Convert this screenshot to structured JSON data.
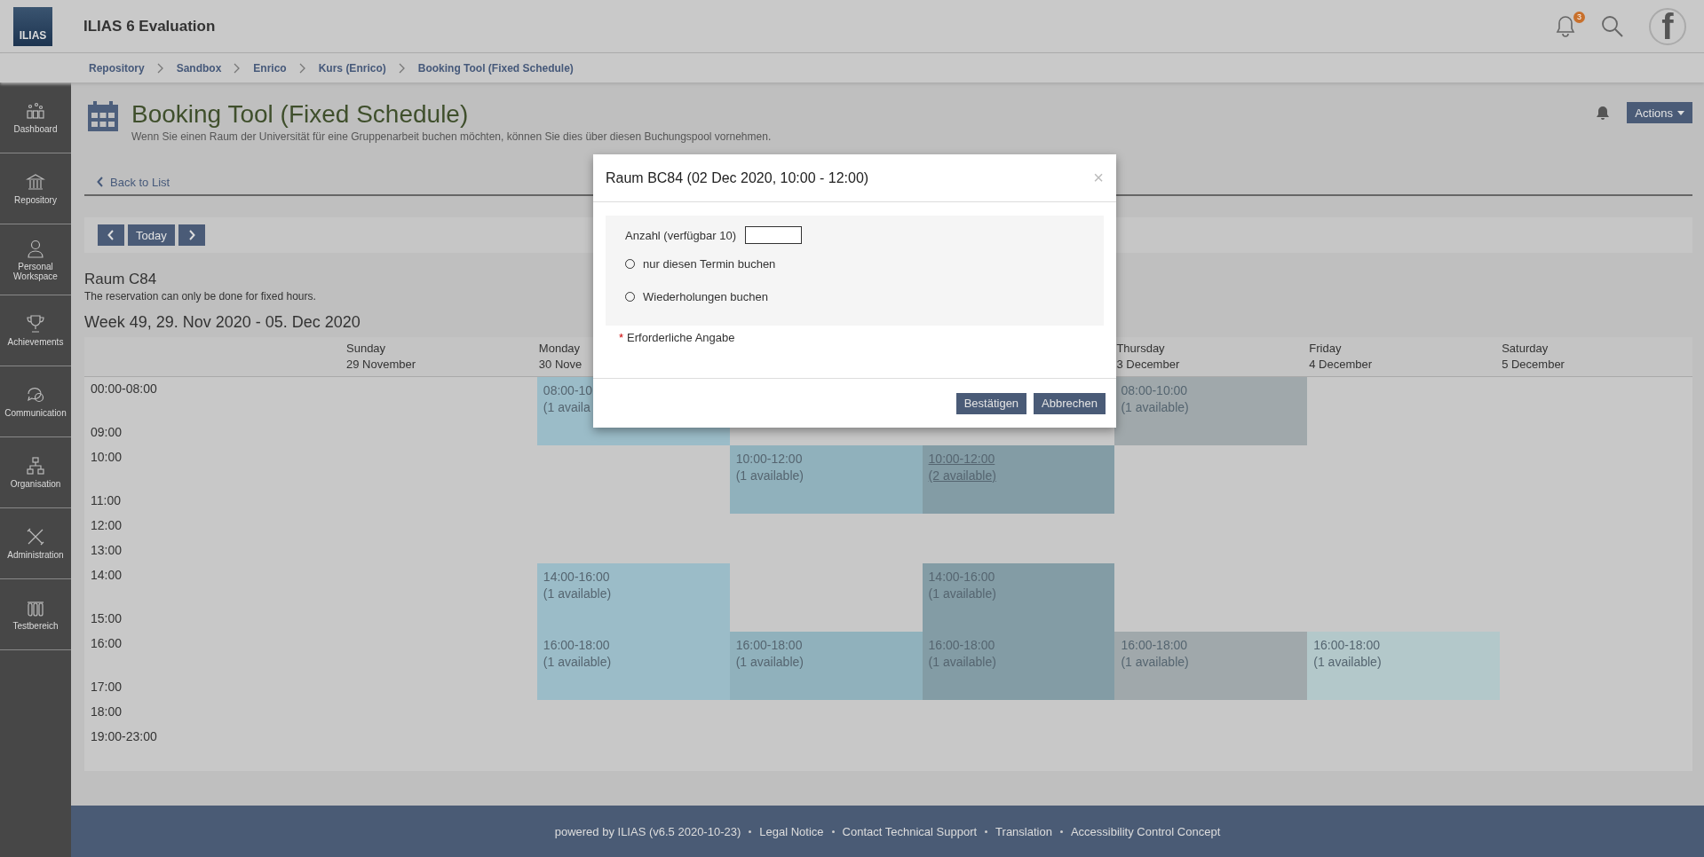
{
  "header": {
    "logo": "ILIAS",
    "title": "ILIAS 6 Evaluation",
    "notification_count": "3",
    "avatar_letter": "f"
  },
  "breadcrumbs": [
    "Repository",
    "Sandbox",
    "Enrico",
    "Kurs (Enrico)",
    "Booking Tool (Fixed Schedule)"
  ],
  "sidebar": {
    "items": [
      {
        "label": "Dashboard"
      },
      {
        "label": "Repository"
      },
      {
        "label": "Personal Workspace"
      },
      {
        "label": "Achievements"
      },
      {
        "label": "Communication"
      },
      {
        "label": "Organisation"
      },
      {
        "label": "Administration"
      },
      {
        "label": "Testbereich"
      }
    ]
  },
  "page": {
    "title": "Booking Tool (Fixed Schedule)",
    "description": "Wenn Sie einen Raum der Universität für eine Gruppenarbeit buchen möchten, können Sie dies über diesen Buchungspool vornehmen.",
    "actions_label": "Actions",
    "back_link": "Back to List"
  },
  "navigation": {
    "today": "Today"
  },
  "schedule": {
    "room": "Raum C84",
    "note": "The reservation can only be done for fixed hours.",
    "week": "Week 49, 29. Nov 2020 - 05. Dec 2020"
  },
  "calendar": {
    "days": [
      {
        "kind": "day",
        "name": "Sunday",
        "date": "29 November"
      },
      {
        "kind": "day",
        "name": "Monday",
        "date": "30 Nove"
      },
      {
        "kind": "covered"
      },
      {
        "kind": "covered"
      },
      {
        "kind": "day",
        "name": "Thursday",
        "date": "3 December"
      },
      {
        "kind": "day",
        "name": "Friday",
        "date": "4 December"
      },
      {
        "kind": "day",
        "name": "Saturday",
        "date": "5 December"
      }
    ],
    "rows": [
      {
        "time": "00:00-08:00",
        "cells": [
          {
            "kind": "empty"
          },
          {
            "kind": "booking",
            "time": "08:00-10",
            "availability": "(1 availa",
            "color": "#9bbcc8",
            "selected": false
          },
          {
            "kind": "empty"
          },
          {
            "kind": "empty"
          },
          {
            "kind": "booking",
            "time": "08:00-10:00",
            "availability": "(1 available)",
            "color": "#a0a8ab",
            "selected": false
          }
        ]
      },
      {
        "time": "09:00"
      },
      {
        "time": "10:00",
        "cells": [
          {
            "kind": "empty"
          },
          {
            "kind": "empty"
          },
          {
            "kind": "booking",
            "time": "10:00-12:00",
            "availability": "(1 available)",
            "color": "#90b1bc",
            "selected": false
          },
          {
            "kind": "booking",
            "time": "10:00-12:00",
            "availability": "(2 available)",
            "color": "#839ca5",
            "selected": true
          }
        ]
      },
      {
        "time": "11:00"
      },
      {
        "time": "12:00"
      },
      {
        "time": "13:00"
      },
      {
        "time": "14:00",
        "cells": [
          {
            "kind": "empty"
          },
          {
            "kind": "booking",
            "time": "14:00-16:00",
            "availability": "(1 available)",
            "color": "#9bbcc8",
            "selected": false
          },
          {
            "kind": "empty"
          },
          {
            "kind": "booking",
            "time": "14:00-16:00",
            "availability": "(1 available)",
            "color": "#839ca5",
            "selected": false
          }
        ]
      },
      {
        "time": "15:00"
      },
      {
        "time": "16:00",
        "cells": [
          {
            "kind": "empty"
          },
          {
            "kind": "booking",
            "time": "16:00-18:00",
            "availability": "(1 available)",
            "color": "#9bbcc8",
            "selected": false
          },
          {
            "kind": "booking",
            "time": "16:00-18:00",
            "availability": "(1 available)",
            "color": "#90b1bc",
            "selected": false
          },
          {
            "kind": "booking",
            "time": "16:00-18:00",
            "availability": "(1 available)",
            "color": "#839ca5",
            "selected": false
          },
          {
            "kind": "booking",
            "time": "16:00-18:00",
            "availability": "(1 available)",
            "color": "#a0a8ab",
            "selected": false
          },
          {
            "kind": "booking",
            "time": "16:00-18:00",
            "availability": "(1 available)",
            "color": "#b3c8ca",
            "selected": false
          }
        ]
      },
      {
        "time": "17:00"
      },
      {
        "time": "18:00"
      },
      {
        "time": "19:00-23:00"
      }
    ]
  },
  "modal": {
    "title": "Raum BC84 (02 Dec 2020, 10:00 - 12:00)",
    "close": "×",
    "quantity_label": "Anzahl (verfügbar 10)",
    "options": [
      {
        "label": "nur diesen Termin buchen",
        "selected": false
      },
      {
        "label": "Wiederholungen buchen",
        "selected": false
      }
    ],
    "required_mark": "*",
    "required_note": "Erforderliche Angabe",
    "buttons": [
      "Bestätigen",
      "Abbrechen"
    ]
  },
  "footer": {
    "powered": "powered by ILIAS (v6.5 2020-10-23)",
    "links": [
      "Legal Notice",
      "Contact Technical Support",
      "Translation",
      "Accessibility Control Concept"
    ]
  }
}
